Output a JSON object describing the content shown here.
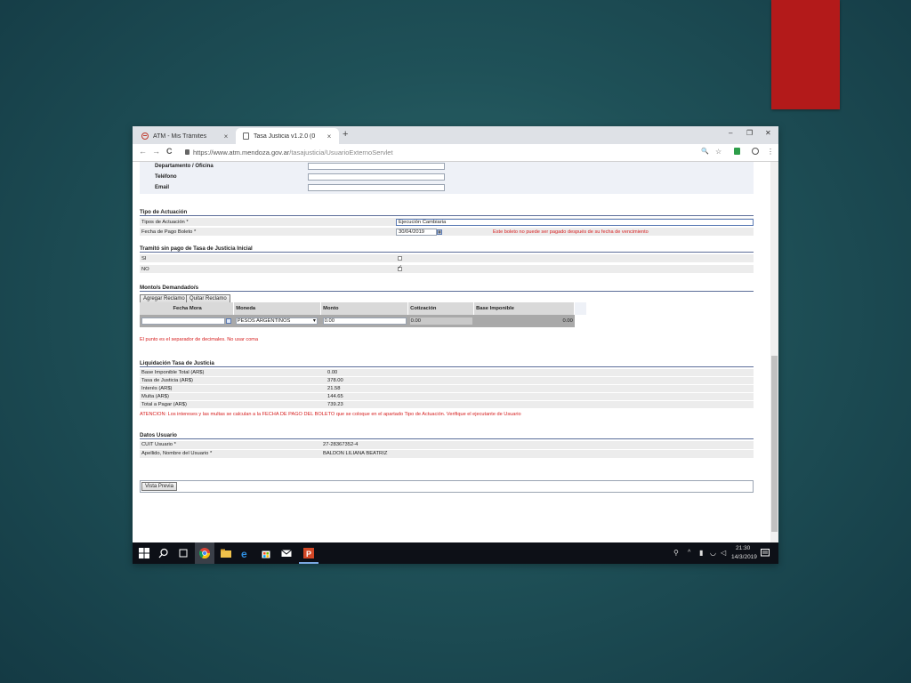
{
  "browser": {
    "tabs": [
      {
        "label": "ATM - Mis Trámites",
        "close": "×"
      },
      {
        "label": "Tasa Justicia v1.2.0 (0",
        "close": "×"
      }
    ],
    "new_tab": "+",
    "window_controls": {
      "minimize": "–",
      "restore": "❐",
      "close": "✕"
    },
    "nav": {
      "back": "←",
      "forward": "→",
      "reload": "C"
    },
    "url_host": "https://www.atm.mendoza.gov.ar",
    "url_path": "/tasajusticia/UsuarioExternoServlet",
    "address_icons": {
      "zoom": "🔍",
      "star": "☆",
      "menu": "⋮"
    }
  },
  "form": {
    "contact_fields": [
      {
        "label": "Departamento / Oficina",
        "value": ""
      },
      {
        "label": "Teléfono",
        "value": ""
      },
      {
        "label": "Email",
        "value": ""
      }
    ],
    "tipo_actuacion": {
      "heading": "Tipo de Actuación",
      "tipos_label": "Tipos de Actuación *",
      "tipos_value": "Ejecución Cambiaria",
      "fecha_label": "Fecha de Pago Boleto *",
      "fecha_value": "30/04/2019",
      "fecha_error": "Este boleto no puede ser pagado después de su fecha de vencimiento"
    },
    "tramito": {
      "heading": "Tramitó sin pago de Tasa de Justicia Inicial",
      "options": [
        {
          "label": "SI",
          "checked": false
        },
        {
          "label": "NO",
          "checked": true
        }
      ]
    },
    "montos": {
      "heading": "Monto/s Demandado/s",
      "add_button": "Agregar Reclamo",
      "remove_button": "Quitar Reclamo",
      "columns": [
        "Fecha Mora",
        "Moneda",
        "Monto",
        "Cotización",
        "Base Imponible"
      ],
      "row": {
        "fecha_mora": "",
        "moneda": "PESOS ARGENTINOS",
        "monto": "0.00",
        "cotizacion": "0.00",
        "base_imponible": "0.00"
      },
      "note": "El punto es el separador de decimales. No usar coma"
    },
    "liquidacion": {
      "heading": "Liquidación Tasa de Justicia",
      "rows": [
        {
          "label": "Base Imponible Total (AR$)",
          "value": "0.00"
        },
        {
          "label": "Tasa de Justicia (AR$)",
          "value": "378.00"
        },
        {
          "label": "Interés (AR$)",
          "value": "21.58"
        },
        {
          "label": "Multa (AR$)",
          "value": "144.65"
        },
        {
          "label": "Total a Pagar (AR$)",
          "value": "739.23"
        }
      ],
      "note": "ATENCIÓN: Los intereses y las multas se calculan a la FECHA DE PAGO DEL BOLETO que se coloque en el apartado Tipo de Actuación. Verifique el ejecutante de Usuario"
    },
    "usuario": {
      "heading": "Datos Usuario",
      "rows": [
        {
          "label": "CUIT Usuario *",
          "value": "27-28367352-4"
        },
        {
          "label": "Apellido, Nombre del Usuario *",
          "value": "BALDON LILIANA BEATRIZ"
        }
      ]
    },
    "vista_previa_button": "Vista Previa"
  },
  "taskbar": {
    "time": "21:30",
    "date": "14/3/2019"
  },
  "colors": {
    "background": "#1f5158",
    "accent_red": "#b31a1a",
    "error_text": "#d62020",
    "section_rule": "#5b6d99"
  }
}
